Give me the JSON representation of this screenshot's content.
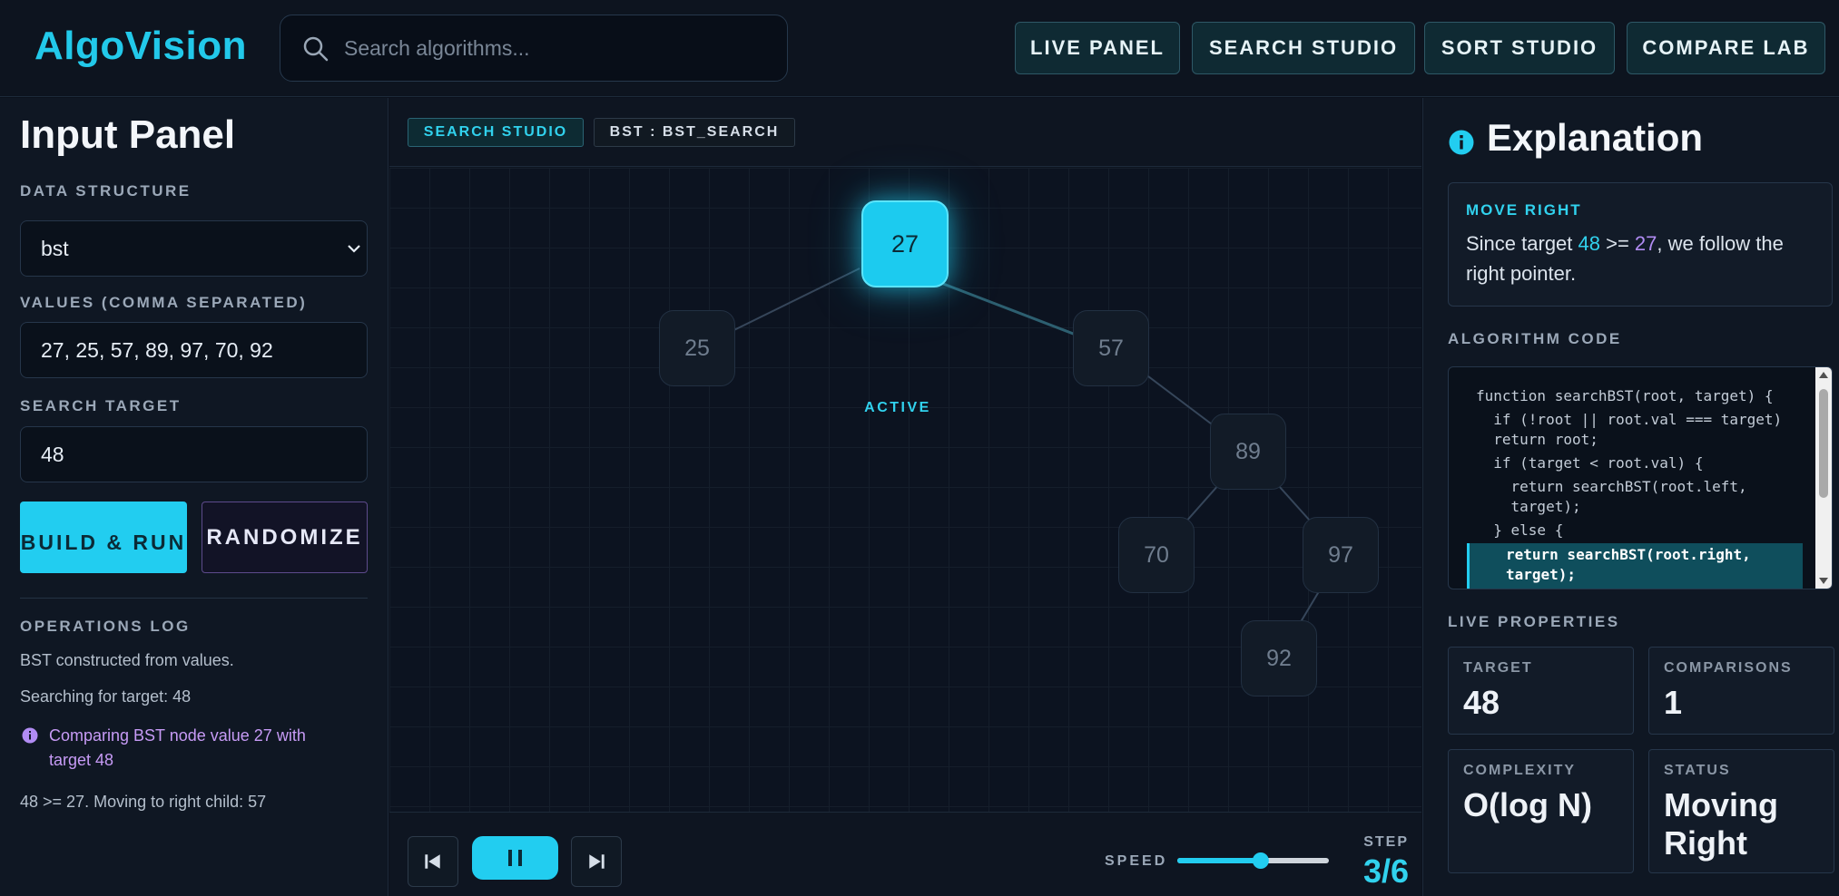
{
  "header": {
    "logo": "AlgoVision",
    "search_placeholder": "Search algorithms...",
    "nav": [
      "LIVE PANEL",
      "SEARCH STUDIO",
      "SORT STUDIO",
      "COMPARE LAB"
    ]
  },
  "input_panel": {
    "title": "Input Panel",
    "structure_label": "DATA STRUCTURE",
    "structure_value": "bst",
    "values_label": "VALUES (COMMA SEPARATED)",
    "values_value": "27, 25, 57, 89, 97, 70, 92",
    "target_label": "SEARCH TARGET",
    "target_value": "48",
    "build_label": "BUILD & RUN",
    "randomize_label": "RANDOMIZE",
    "log_label": "OPERATIONS LOG",
    "log": [
      "BST constructed from values.",
      "Searching for target: 48",
      "Comparing BST node value 27 with target 48",
      "48 >= 27. Moving to right child: 57"
    ]
  },
  "studio": {
    "chip_mode": "SEARCH STUDIO",
    "chip_algo": "BST : BST_SEARCH",
    "nodes": [
      "27",
      "25",
      "57",
      "89",
      "70",
      "97",
      "92"
    ],
    "active_tag": "ACTIVE",
    "speed_label": "SPEED",
    "speed_value": 0.55,
    "step_label": "STEP",
    "step_value": "3/6"
  },
  "explanation": {
    "title": "Explanation",
    "move_title": "MOVE RIGHT",
    "move_text_parts": [
      "Since target ",
      "48",
      " >= ",
      "27",
      ", we follow the right pointer."
    ],
    "code_label": "ALGORITHM CODE",
    "code_lines": [
      "function searchBST(root, target) {",
      "  if (!root || root.val === target)",
      "  return root;",
      "  if (target < root.val) {",
      "    return searchBST(root.left,",
      "    target);",
      "  } else {"
    ],
    "code_highlight": [
      "return searchBST(root.right,",
      "target);"
    ],
    "props_label": "LIVE PROPERTIES",
    "props": {
      "target_label": "TARGET",
      "target_value": "48",
      "comparisons_label": "COMPARISONS",
      "comparisons_value": "1",
      "complexity_label": "COMPLEXITY",
      "complexity_value": "O(log N)",
      "status_label": "STATUS",
      "status_value": "Moving Right"
    }
  },
  "colors": {
    "accent": "#22cdf0",
    "violet": "#b18cf3",
    "background": "#0b111c"
  },
  "icons": [
    "search-icon",
    "chevron-down-icon",
    "info-icon",
    "skip-back-icon",
    "pause-icon",
    "skip-forward-icon"
  ]
}
